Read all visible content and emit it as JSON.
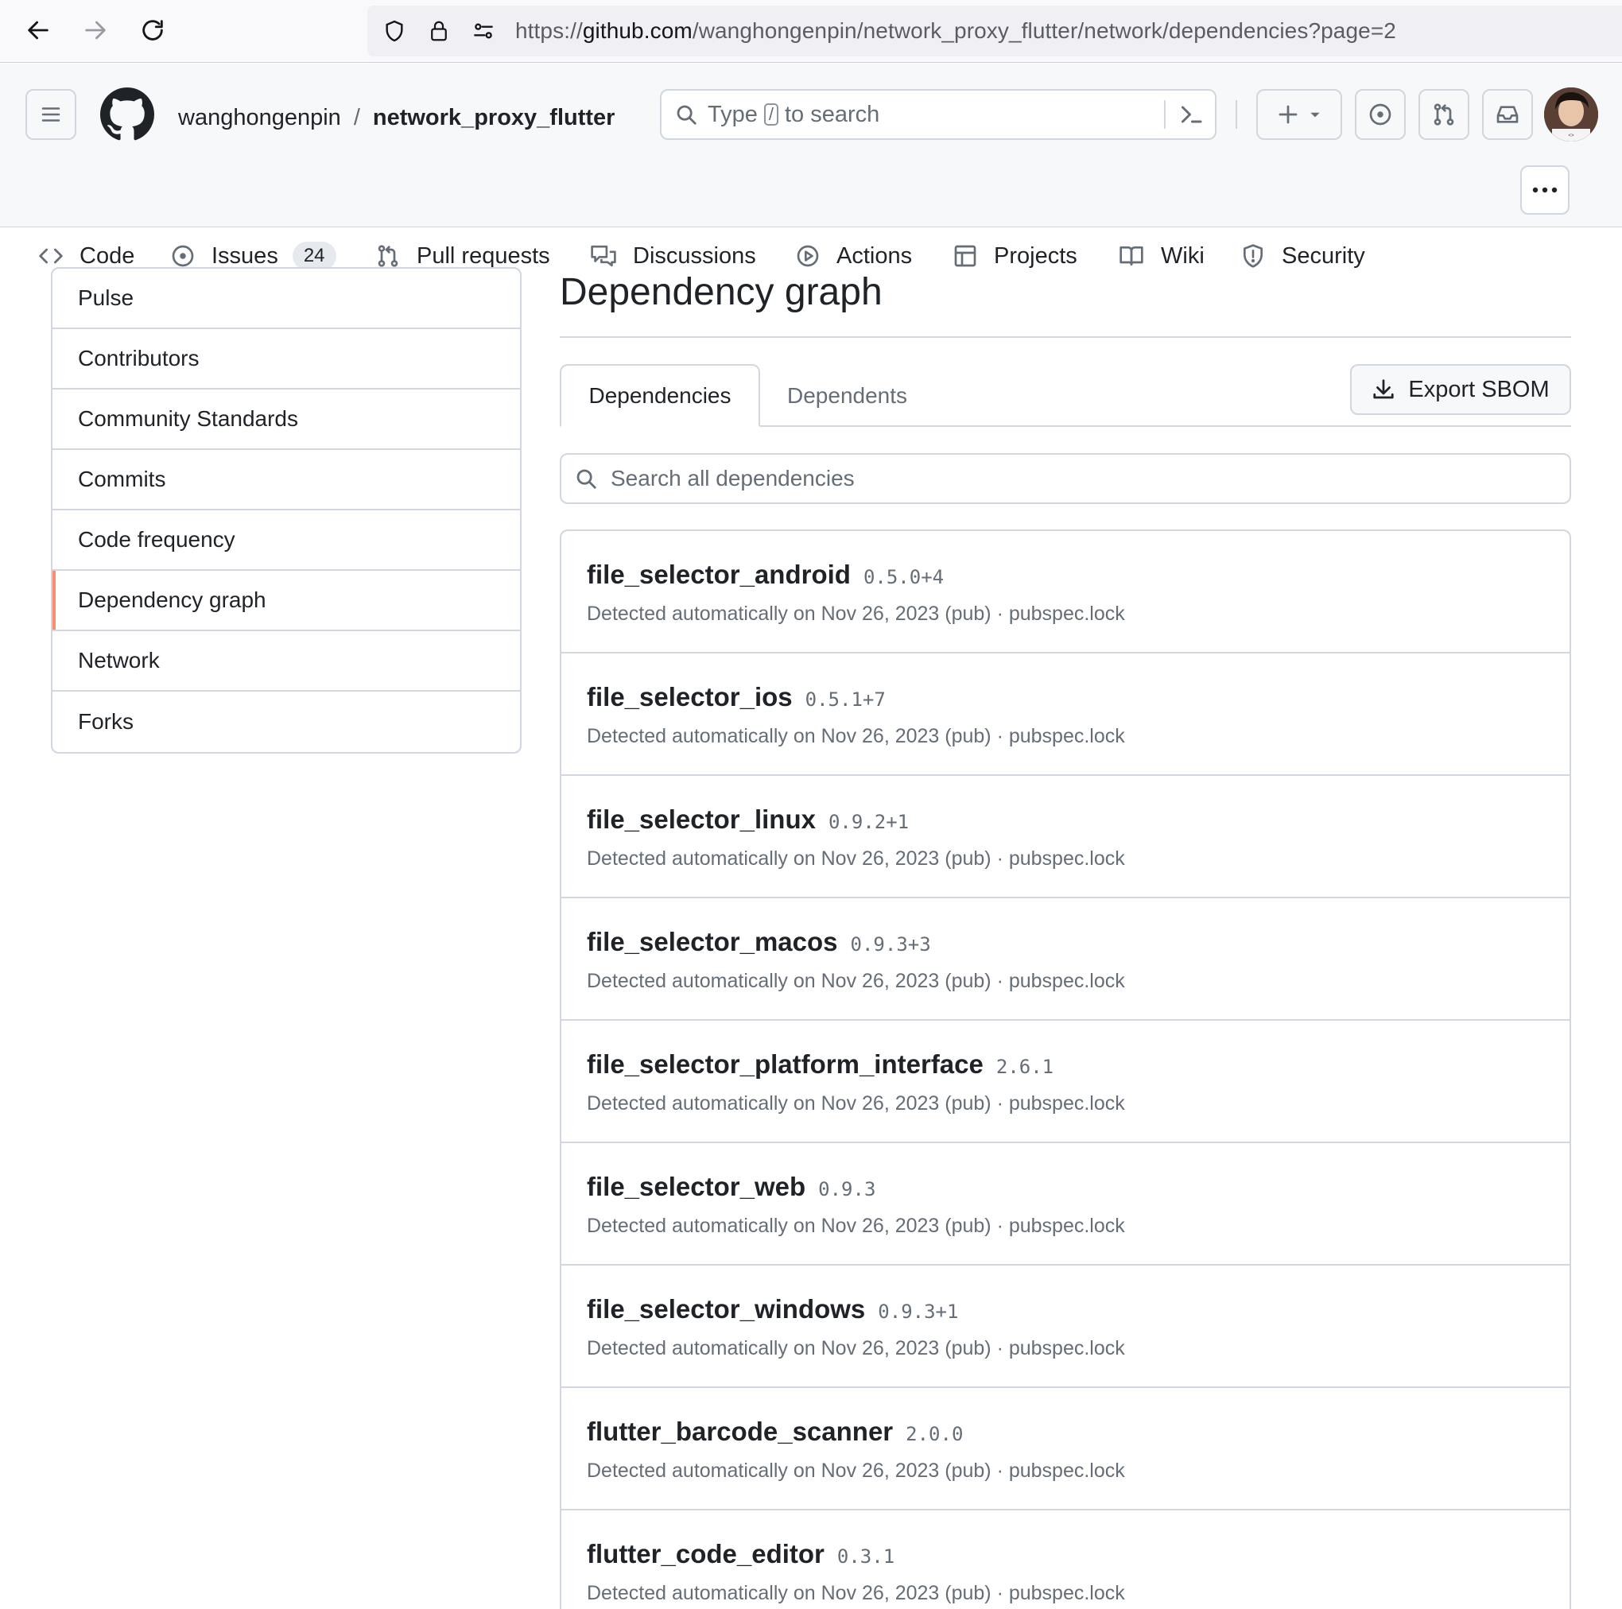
{
  "browser": {
    "url_prefix": "https://",
    "url_host": "github.com",
    "url_path": "/wanghongenpin/network_proxy_flutter/network/dependencies?page=2"
  },
  "header": {
    "owner": "wanghongenpin",
    "separator": "/",
    "repo": "network_proxy_flutter",
    "search_placeholder_before": "Type",
    "search_key": "/",
    "search_placeholder_after": "to search"
  },
  "repo_tabs": [
    {
      "label": "Code",
      "icon": "code-icon"
    },
    {
      "label": "Issues",
      "icon": "issue-opened-icon",
      "count": "24"
    },
    {
      "label": "Pull requests",
      "icon": "git-pull-request-icon"
    },
    {
      "label": "Discussions",
      "icon": "comment-discussion-icon"
    },
    {
      "label": "Actions",
      "icon": "play-icon"
    },
    {
      "label": "Projects",
      "icon": "table-icon"
    },
    {
      "label": "Wiki",
      "icon": "book-icon"
    },
    {
      "label": "Security",
      "icon": "shield-icon"
    }
  ],
  "sidebar": {
    "items": [
      {
        "label": "Pulse"
      },
      {
        "label": "Contributors"
      },
      {
        "label": "Community Standards"
      },
      {
        "label": "Commits"
      },
      {
        "label": "Code frequency"
      },
      {
        "label": "Dependency graph",
        "active": true
      },
      {
        "label": "Network"
      },
      {
        "label": "Forks"
      }
    ]
  },
  "main": {
    "title": "Dependency graph",
    "tabs": [
      {
        "label": "Dependencies",
        "active": true
      },
      {
        "label": "Dependents"
      }
    ],
    "export_label": "Export SBOM",
    "search_placeholder": "Search all dependencies"
  },
  "dependencies": [
    {
      "name": "file_selector_android",
      "version": "0.5.0+4",
      "meta": "Detected automatically on Nov 26, 2023 (pub) · pubspec.lock"
    },
    {
      "name": "file_selector_ios",
      "version": "0.5.1+7",
      "meta": "Detected automatically on Nov 26, 2023 (pub) · pubspec.lock"
    },
    {
      "name": "file_selector_linux",
      "version": "0.9.2+1",
      "meta": "Detected automatically on Nov 26, 2023 (pub) · pubspec.lock"
    },
    {
      "name": "file_selector_macos",
      "version": "0.9.3+3",
      "meta": "Detected automatically on Nov 26, 2023 (pub) · pubspec.lock"
    },
    {
      "name": "file_selector_platform_interface",
      "version": "2.6.1",
      "meta": "Detected automatically on Nov 26, 2023 (pub) · pubspec.lock"
    },
    {
      "name": "file_selector_web",
      "version": "0.9.3",
      "meta": "Detected automatically on Nov 26, 2023 (pub) · pubspec.lock"
    },
    {
      "name": "file_selector_windows",
      "version": "0.9.3+1",
      "meta": "Detected automatically on Nov 26, 2023 (pub) · pubspec.lock"
    },
    {
      "name": "flutter_barcode_scanner",
      "version": "2.0.0",
      "meta": "Detected automatically on Nov 26, 2023 (pub) · pubspec.lock"
    },
    {
      "name": "flutter_code_editor",
      "version": "0.3.1",
      "meta": "Detected automatically on Nov 26, 2023 (pub) · pubspec.lock"
    }
  ],
  "colors": {
    "active_marker": "#fd8c73",
    "border": "#d0d7de",
    "muted_text": "#656d76"
  }
}
